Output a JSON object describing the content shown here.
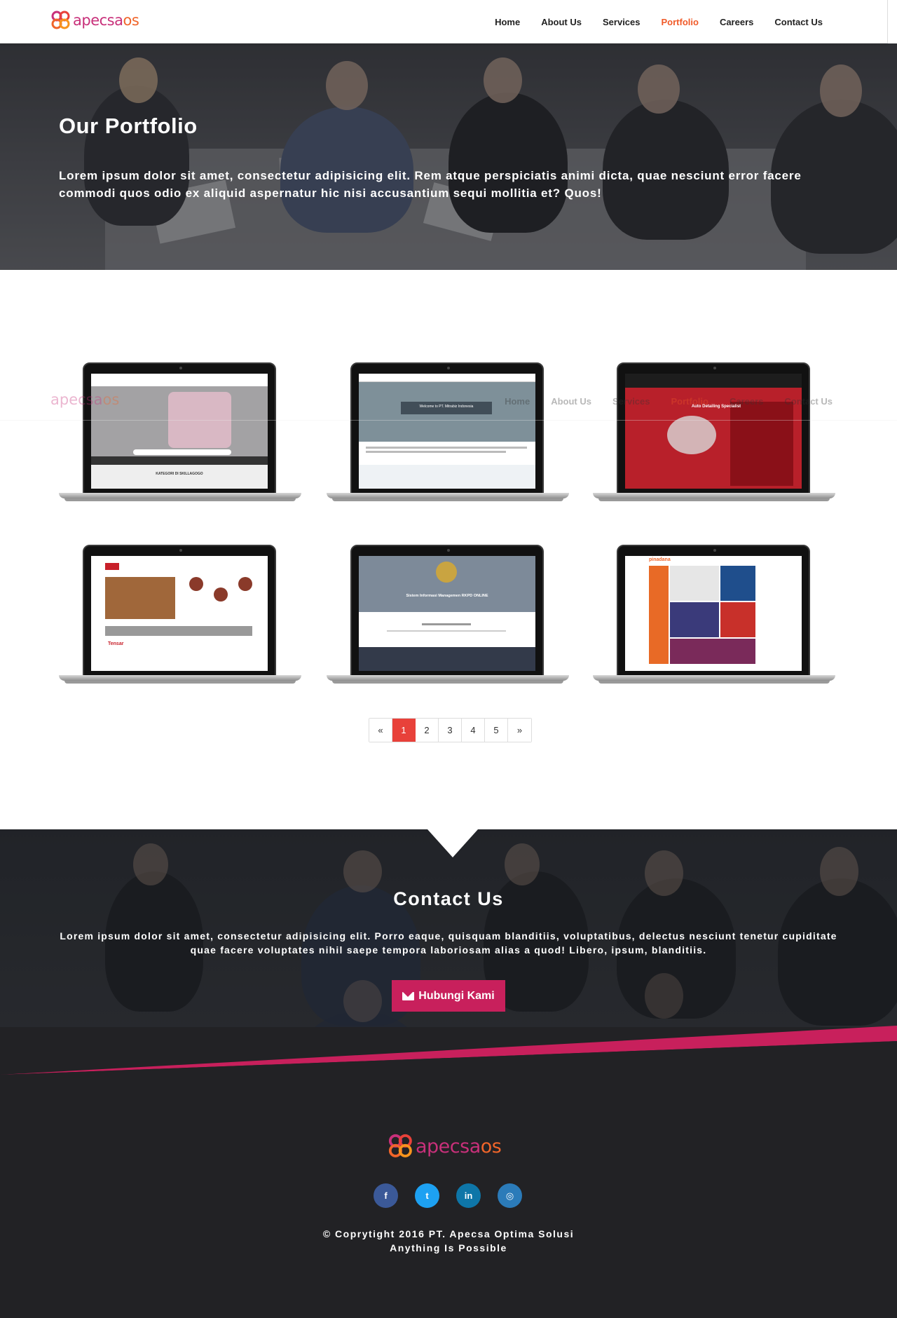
{
  "brand": {
    "part1": "apecsa",
    "part2": "os",
    "logo_icon": "apecsaos-logo-icon"
  },
  "nav": {
    "items": [
      {
        "label": "Home",
        "active": false
      },
      {
        "label": "About Us",
        "active": false
      },
      {
        "label": "Services",
        "active": false
      },
      {
        "label": "Portfolio",
        "active": true
      },
      {
        "label": "Careers",
        "active": false
      },
      {
        "label": "Contact Us",
        "active": false
      }
    ],
    "active_color": "#f05a28"
  },
  "hero": {
    "title": "Our Portfolio",
    "text": "Lorem ipsum dolor sit amet, consectetur adipisicing elit. Rem atque perspiciatis animi dicta, quae nesciunt error facere commodi quos odio ex aliquid aspernatur hic nisi accusantium sequi mollitia et? Quos!"
  },
  "portfolio": {
    "items": [
      {
        "screen_caption": "KATEGORI DI SKILLAGOGO"
      },
      {
        "screen_caption": "Welcome to PT. Mitrabiz Indonesia"
      },
      {
        "screen_caption": "Auto Detailing Specialist"
      },
      {
        "screen_caption": "Tensar"
      },
      {
        "screen_caption": "Sistem Informasi Managemen RKPD ONLINE"
      },
      {
        "screen_caption": "pinadana"
      }
    ],
    "pagination": {
      "prev": "«",
      "pages": [
        "1",
        "2",
        "3",
        "4",
        "5"
      ],
      "current": "1",
      "next": "»"
    }
  },
  "contact": {
    "title": "Contact Us",
    "text": "Lorem ipsum dolor sit amet, consectetur adipisicing elit. Porro eaque, quisquam blanditiis, voluptatibus, delectus nesciunt tenetur cupiditate quae facere voluptates nihil saepe tempora laboriosam alias a quod! Libero, ipsum, blanditiis.",
    "button_label": "Hubungi Kami",
    "button_color": "#c8205c"
  },
  "footer": {
    "socials": [
      {
        "name": "facebook",
        "glyph": "f"
      },
      {
        "name": "twitter",
        "glyph": "t"
      },
      {
        "name": "linkedin",
        "glyph": "in"
      },
      {
        "name": "instagram",
        "glyph": "◎"
      }
    ],
    "copyright": "© Coprytight 2016 PT. Apecsa Optima Solusi",
    "tagline": "Anything Is Possible"
  }
}
